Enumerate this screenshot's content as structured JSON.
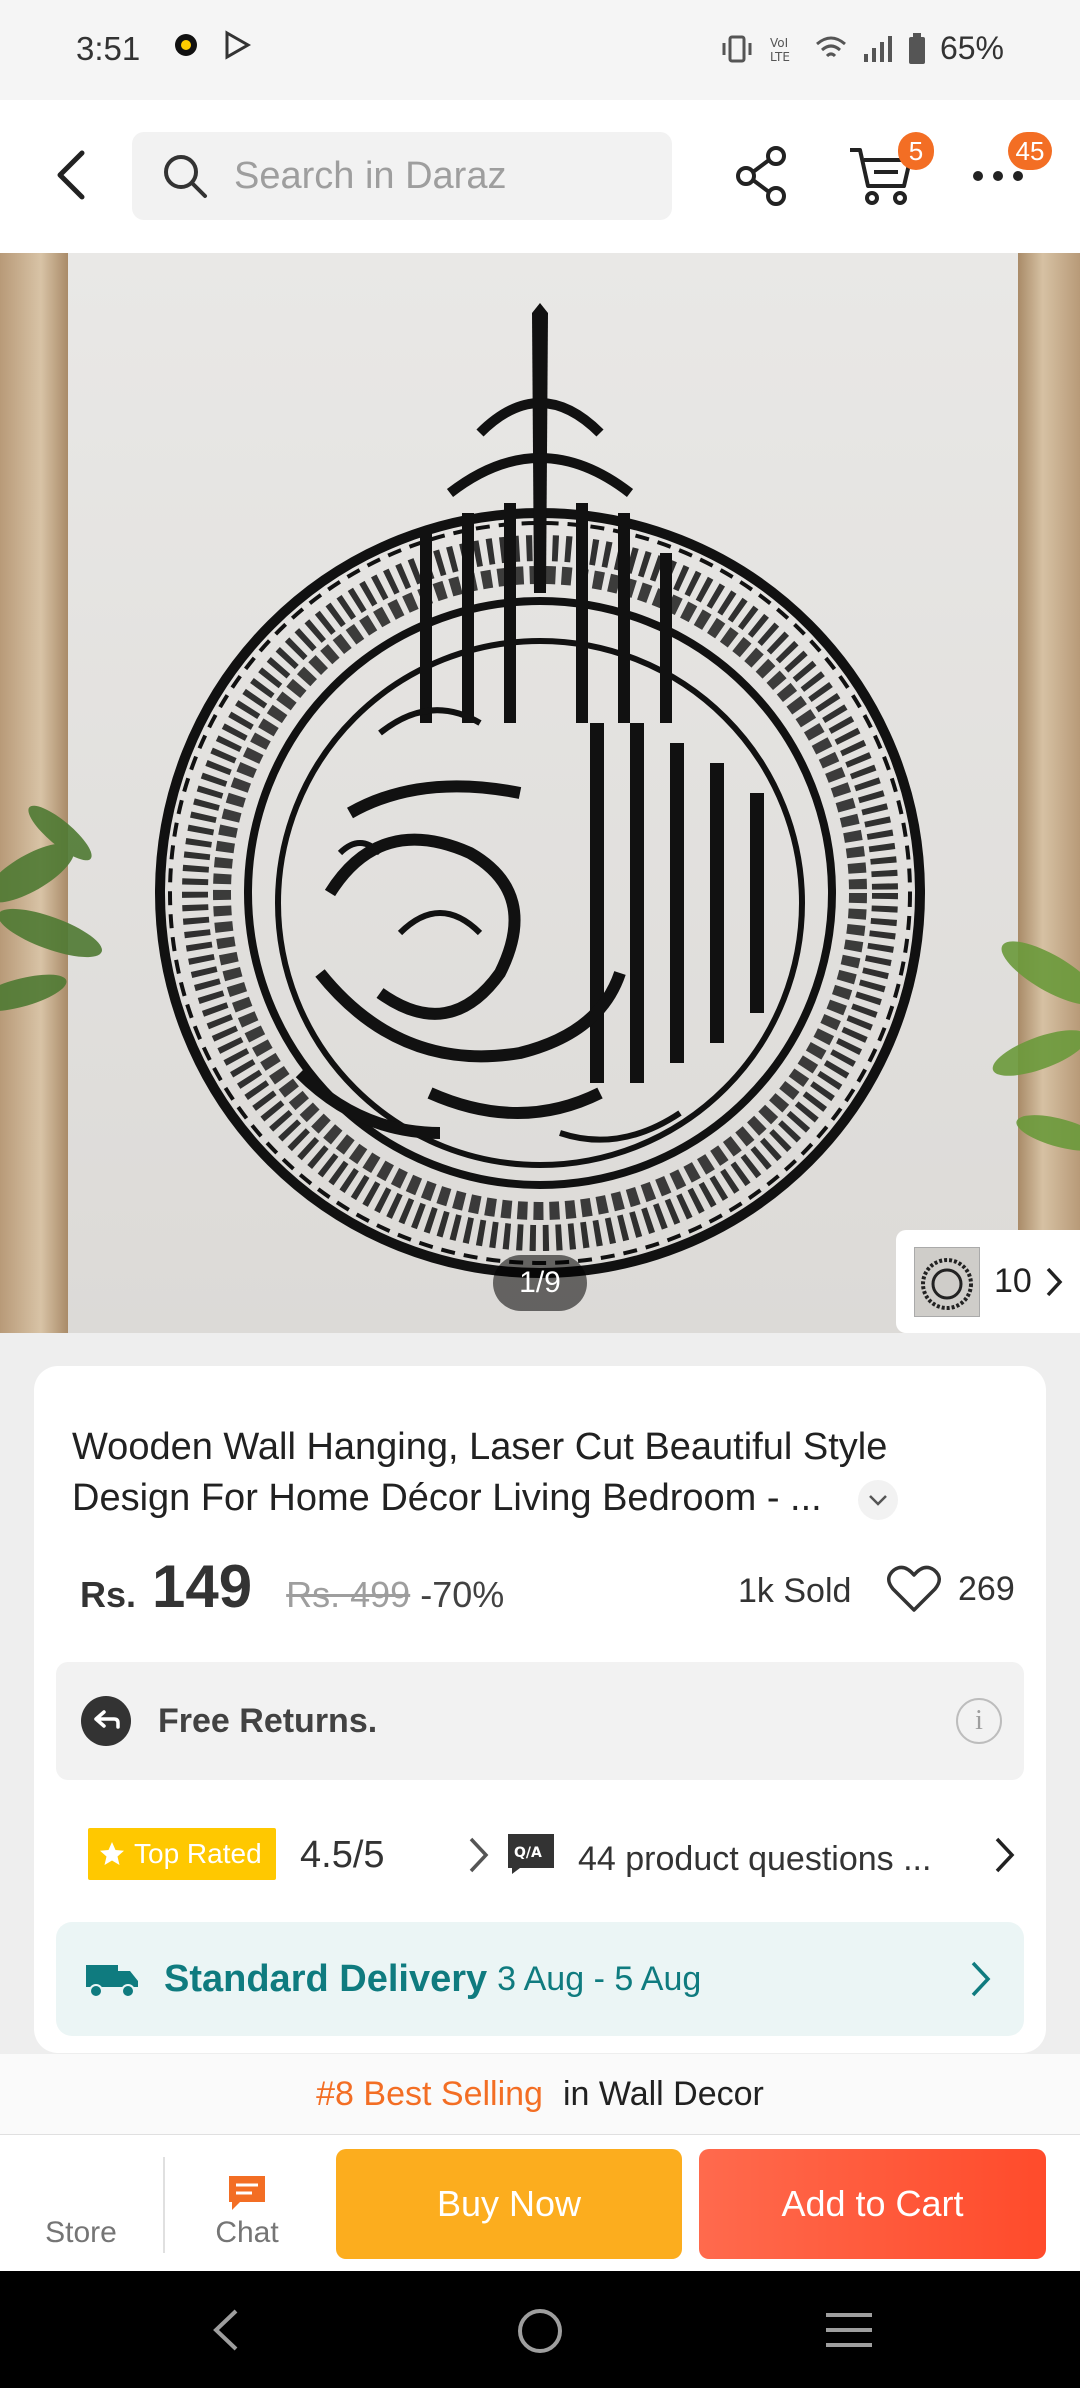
{
  "status_bar": {
    "time": "3:51",
    "battery": "65%",
    "icons": [
      "notification-dot-icon",
      "play-store-icon",
      "vibrate-icon",
      "volte-icon",
      "wifi-icon",
      "signal-icon",
      "battery-icon"
    ]
  },
  "top_bar": {
    "search_placeholder": "Search in Daraz",
    "cart_badge": "5",
    "more_badge": "45",
    "icons": [
      "back-arrow-icon",
      "search-icon",
      "share-icon",
      "cart-icon",
      "more-dots-icon"
    ]
  },
  "gallery": {
    "page_indicator": "1/9",
    "thumbnails_count": "10"
  },
  "product": {
    "title": "Wooden Wall Hanging, Laser Cut Beautiful Style Design For Home Décor Living Bedroom - ...",
    "currency": "Rs.",
    "price": "149",
    "original_price": "Rs. 499",
    "discount": "-70%",
    "sold": "1k Sold",
    "wishlist_count": "269"
  },
  "free_returns": {
    "label": "Free Returns."
  },
  "rating": {
    "badge": "Top Rated",
    "value": "4.5/5",
    "qa_badge": "Q/A",
    "qa_text": "44 product questions ..."
  },
  "delivery": {
    "label": "Standard Delivery",
    "dates": "3 Aug - 5 Aug"
  },
  "best_selling": {
    "rank": "#8 Best Selling",
    "category": "in Wall Decor"
  },
  "action_bar": {
    "store": "Store",
    "chat": "Chat",
    "buy_now": "Buy Now",
    "add_to_cart": "Add to Cart"
  },
  "colors": {
    "accent_orange": "#f36e24",
    "buy_now": "#fcad1e",
    "add_to_cart": "#ff5533",
    "delivery_teal": "#0f7b7f",
    "top_rated_yellow": "#ffc800"
  }
}
